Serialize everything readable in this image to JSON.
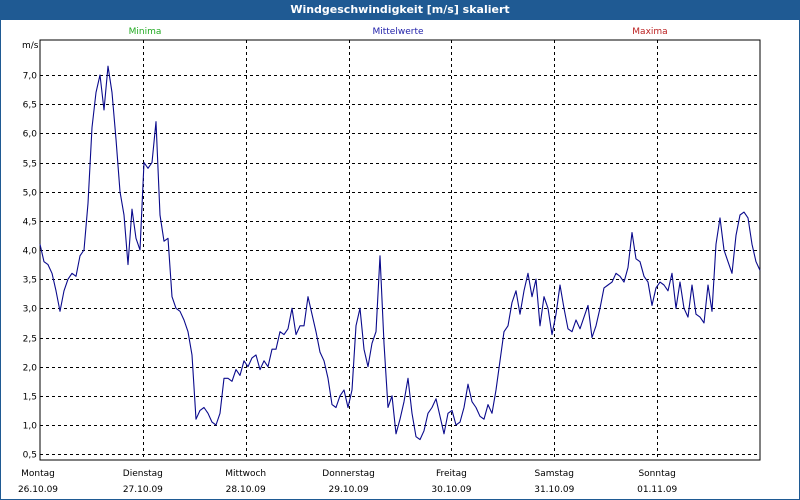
{
  "window": {
    "title": "Windgeschwindigkeit [m/s] skaliert"
  },
  "legend": {
    "minima": "Minima",
    "mittelwerte": "Mittelwerte",
    "maxima": "Maxima"
  },
  "colors": {
    "title_bar": "#1f5a93",
    "minima": "#22aa22",
    "mittelwerte": "#2222aa",
    "maxima": "#bb2222",
    "series_line": "#0a0a8c"
  },
  "chart_data": {
    "type": "line",
    "title": "Windgeschwindigkeit [m/s] skaliert",
    "ylabel": "m/s",
    "ylim": [
      0.4,
      7.6
    ],
    "yticks": [
      "0,5",
      "1,0",
      "1,5",
      "2,0",
      "2,5",
      "3,0",
      "3,5",
      "4,0",
      "4,5",
      "5,0",
      "5,5",
      "6,0",
      "6,5",
      "7,0"
    ],
    "xlim": [
      0,
      7
    ],
    "x_days": [
      {
        "day": "Montag",
        "date": "26.10.09"
      },
      {
        "day": "Dienstag",
        "date": "27.10.09"
      },
      {
        "day": "Mittwoch",
        "date": "28.10.09"
      },
      {
        "day": "Donnerstag",
        "date": "29.10.09"
      },
      {
        "day": "Freitag",
        "date": "30.10.09"
      },
      {
        "day": "Samstag",
        "date": "31.10.09"
      },
      {
        "day": "Sonntag",
        "date": "01.11.09"
      }
    ],
    "grid": true,
    "series": [
      {
        "name": "Mittelwerte",
        "values": [
          4.1,
          3.8,
          3.75,
          3.6,
          3.3,
          2.95,
          3.3,
          3.5,
          3.6,
          3.55,
          3.9,
          4.0,
          4.8,
          6.1,
          6.7,
          7.0,
          6.4,
          7.15,
          6.7,
          5.9,
          5.0,
          4.6,
          3.75,
          4.7,
          4.2,
          4.0,
          5.5,
          5.4,
          5.5,
          6.2,
          4.6,
          4.15,
          4.2,
          3.2,
          3.0,
          2.95,
          2.8,
          2.6,
          2.2,
          1.1,
          1.25,
          1.3,
          1.2,
          1.05,
          1.0,
          1.2,
          1.8,
          1.8,
          1.75,
          1.95,
          1.85,
          2.1,
          2.0,
          2.15,
          2.2,
          1.95,
          2.1,
          2.0,
          2.3,
          2.3,
          2.6,
          2.55,
          2.65,
          3.0,
          2.55,
          2.7,
          2.7,
          3.2,
          2.9,
          2.6,
          2.25,
          2.1,
          1.8,
          1.35,
          1.3,
          1.5,
          1.6,
          1.3,
          1.6,
          2.7,
          3.0,
          2.3,
          2.0,
          2.4,
          2.6,
          3.9,
          2.4,
          1.3,
          1.5,
          0.85,
          1.1,
          1.4,
          1.8,
          1.2,
          0.8,
          0.75,
          0.9,
          1.2,
          1.3,
          1.45,
          1.15,
          0.85,
          1.2,
          1.25,
          1.0,
          1.05,
          1.3,
          1.7,
          1.4,
          1.3,
          1.15,
          1.1,
          1.35,
          1.2,
          1.6,
          2.1,
          2.6,
          2.7,
          3.1,
          3.3,
          2.9,
          3.3,
          3.6,
          3.2,
          3.5,
          2.7,
          3.2,
          3.0,
          2.55,
          2.9,
          3.4,
          3.0,
          2.65,
          2.6,
          2.8,
          2.65,
          2.85,
          3.05,
          2.5,
          2.7,
          3.0,
          3.35,
          3.4,
          3.45,
          3.6,
          3.55,
          3.45,
          3.7,
          4.3,
          3.85,
          3.8,
          3.55,
          3.45,
          3.05,
          3.35,
          3.45,
          3.4,
          3.3,
          3.6,
          3.0,
          3.45,
          3.0,
          2.85,
          3.4,
          2.9,
          2.85,
          2.75,
          3.4,
          2.95,
          4.1,
          4.55,
          4.0,
          3.8,
          3.6,
          4.25,
          4.6,
          4.65,
          4.55,
          4.1,
          3.8,
          3.65
        ]
      }
    ]
  }
}
